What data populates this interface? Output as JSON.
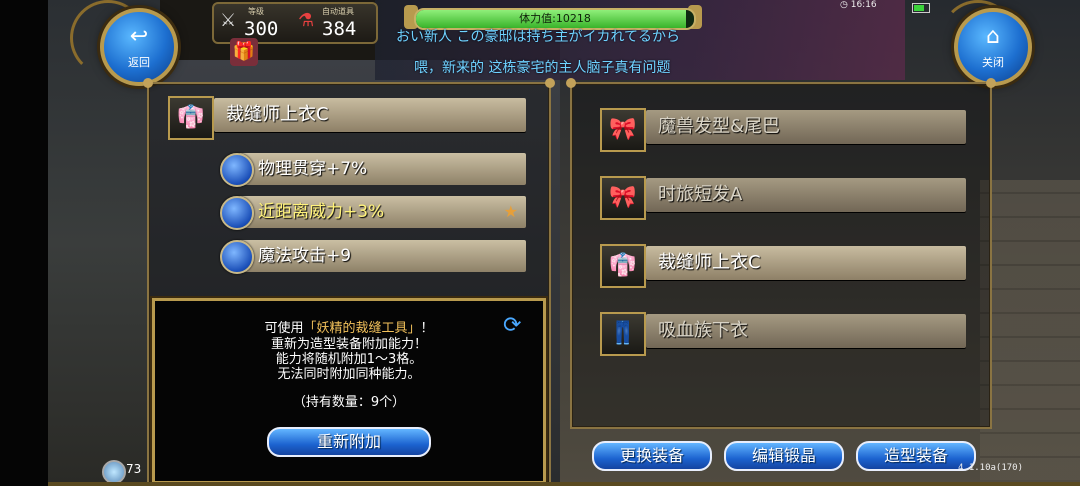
{
  "header": {
    "back_label": "返回",
    "close_label": "关闭",
    "resources": {
      "level_caption": "等级",
      "level_value": "300",
      "items_caption": "自动道具",
      "items_value": "384"
    },
    "stamina": {
      "label": "体力值:10218",
      "fill_fraction": 0.97
    },
    "clock": "16:16"
  },
  "chat": {
    "line1": "おい新人 この豪邸は持ち主がイカれてるから",
    "line2": "喂，新来的 这栋豪宅的主人脑子真有问题"
  },
  "left_panel": {
    "item_name": "裁缝师上衣C",
    "options": [
      {
        "label": "物理贯穿+7%",
        "highlight": false
      },
      {
        "label": "近距离威力+3%",
        "highlight": true
      },
      {
        "label": "魔法攻击+9",
        "highlight": false
      }
    ]
  },
  "info_box": {
    "line1_prefix": "可使用",
    "line1_item": "「妖精的裁缝工具」",
    "line1_suffix": "！",
    "line2": "重新为造型装备附加能力！",
    "line3": "能力将随机附加1～3格。",
    "line4": "无法同时附加同种能力。",
    "count_text": "（持有数量：9个）",
    "reattach_button": "重新附加"
  },
  "right_panel": {
    "items": [
      {
        "label": "魔兽发型&尾巴",
        "icon": "ribbon-icon",
        "dim": true
      },
      {
        "label": "时旅短发A",
        "icon": "ribbon-icon",
        "dim": true
      },
      {
        "label": "裁缝师上衣C",
        "icon": "shirt-icon",
        "dim": false
      },
      {
        "label": "吸血族下衣",
        "icon": "pants-icon",
        "dim": true
      }
    ]
  },
  "bottom_buttons": {
    "change_equipment": "更换装备",
    "edit_forge": "编辑锻晶",
    "style_equipment": "造型装备"
  },
  "footer": {
    "crystal_count": "73",
    "version": "4.1.10a(170)"
  }
}
